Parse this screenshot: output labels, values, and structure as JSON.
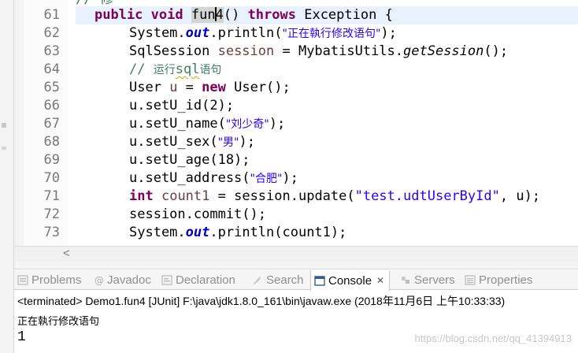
{
  "editor": {
    "partial_top_text": "// 修",
    "lines": [
      {
        "num": "61"
      },
      {
        "num": "62"
      },
      {
        "num": "63"
      },
      {
        "num": "64"
      },
      {
        "num": "65"
      },
      {
        "num": "66"
      },
      {
        "num": "67"
      },
      {
        "num": "68"
      },
      {
        "num": "69"
      },
      {
        "num": "70"
      },
      {
        "num": "71"
      },
      {
        "num": "72"
      },
      {
        "num": "73"
      }
    ],
    "code": {
      "l61": {
        "kw1": "public",
        "kw2": "void",
        "name_a": "fun",
        "name_b": "4",
        "rest": "() ",
        "kw3": "throws",
        "rest2": " Exception {"
      },
      "l62": {
        "a": "System.",
        "f": "out",
        "b": ".println(",
        "s": "\"正在執行修改语句\"",
        "c": ");"
      },
      "l63": {
        "a": "SqlSession ",
        "v": "session",
        "b": " = MybatisUtils.",
        "m": "getSession",
        "c": "();"
      },
      "l64": {
        "c1": "// ",
        "c2": "运行",
        "c3": "sql",
        "c4": "语句"
      },
      "l65": {
        "a": "User ",
        "v": "u",
        "b": " = ",
        "kw": "new",
        "c": " User();"
      },
      "l66": {
        "a": "u.setU_id(2);"
      },
      "l67": {
        "a": "u.setU_name(",
        "s": "\"刘少奇\"",
        "c": ");"
      },
      "l68": {
        "a": "u.setU_sex(",
        "s": "\"男\"",
        "c": ");"
      },
      "l69": {
        "a": "u.setU_age(18);"
      },
      "l70": {
        "a": "u.setU_address(",
        "s": "\"合肥\"",
        "c": ");"
      },
      "l71": {
        "kw": "int",
        "sp": " ",
        "v": "count1",
        "b": " = session.update(",
        "s": "\"test.udtUserById\"",
        "c": ", u);"
      },
      "l72": {
        "a": "session.commit();"
      },
      "l73": {
        "a": "System.",
        "f": "out",
        "b": ".println(count1);"
      }
    }
  },
  "scroll": {
    "left_arrow": "<"
  },
  "tabs": [
    {
      "label": "Problems",
      "icon": "problems-icon"
    },
    {
      "label": "Javadoc",
      "icon": "javadoc-icon"
    },
    {
      "label": "Declaration",
      "icon": "declaration-icon"
    },
    {
      "label": "Search",
      "icon": "search-icon"
    },
    {
      "label": "Console",
      "icon": "console-icon",
      "close": "✕"
    },
    {
      "label": "Servers",
      "icon": "servers-icon"
    },
    {
      "label": "Properties",
      "icon": "properties-icon"
    }
  ],
  "console": {
    "header": "<terminated> Demo1.fun4 [JUnit] F:\\java\\jdk1.8.0_161\\bin\\javaw.exe (2018年11月6日 上午10:33:33)",
    "output_line1": "正在執行修改语句",
    "output_line2": "1"
  },
  "watermark": "https://blog.csdn.net/qq_41394913",
  "colors": {
    "keyword": "#7f0055",
    "string": "#2a00ff",
    "field": "#0000c0",
    "comment": "#3f7f5f",
    "current_line": "#e8f2fe"
  }
}
